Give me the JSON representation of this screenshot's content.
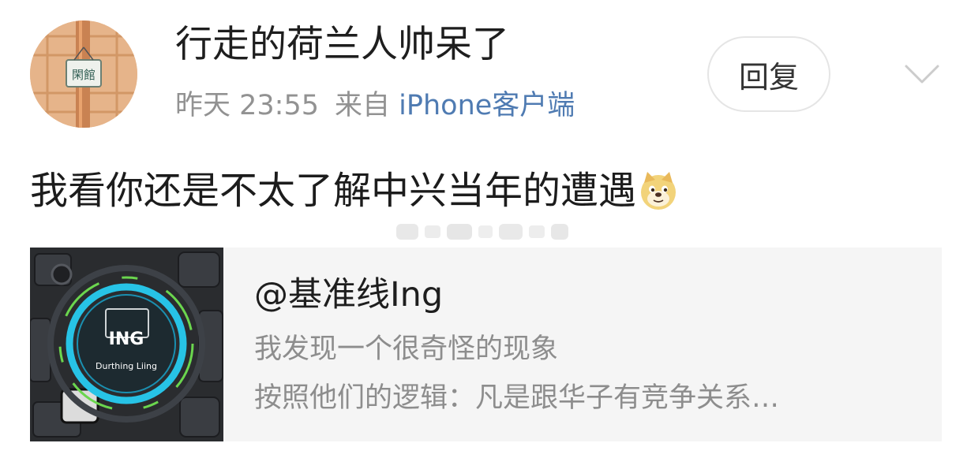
{
  "post": {
    "author": "行走的荷兰人帅呆了",
    "time": "昨天 23:55",
    "source_prefix": "来自",
    "client": "iPhone客户端",
    "reply_label": "回复",
    "text": "我看你还是不太了解中兴当年的遭遇",
    "emoji": "doge-emoji",
    "avatar_sign_text": "閑館"
  },
  "quote_card": {
    "title": "@基准线Ing",
    "line1": "我发现一个很奇怪的现象",
    "line2": "按照他们的逻辑：凡是跟华子有竞争关系…",
    "thumb_badge": "ING",
    "thumb_caption": "Durthing Liing"
  },
  "icons": {
    "more": "chevron-down-icon"
  },
  "colors": {
    "link_blue": "#4f7bb2",
    "meta_gray": "#929292",
    "card_bg": "#f5f5f5",
    "thumb_accent": "#27c3e6"
  }
}
